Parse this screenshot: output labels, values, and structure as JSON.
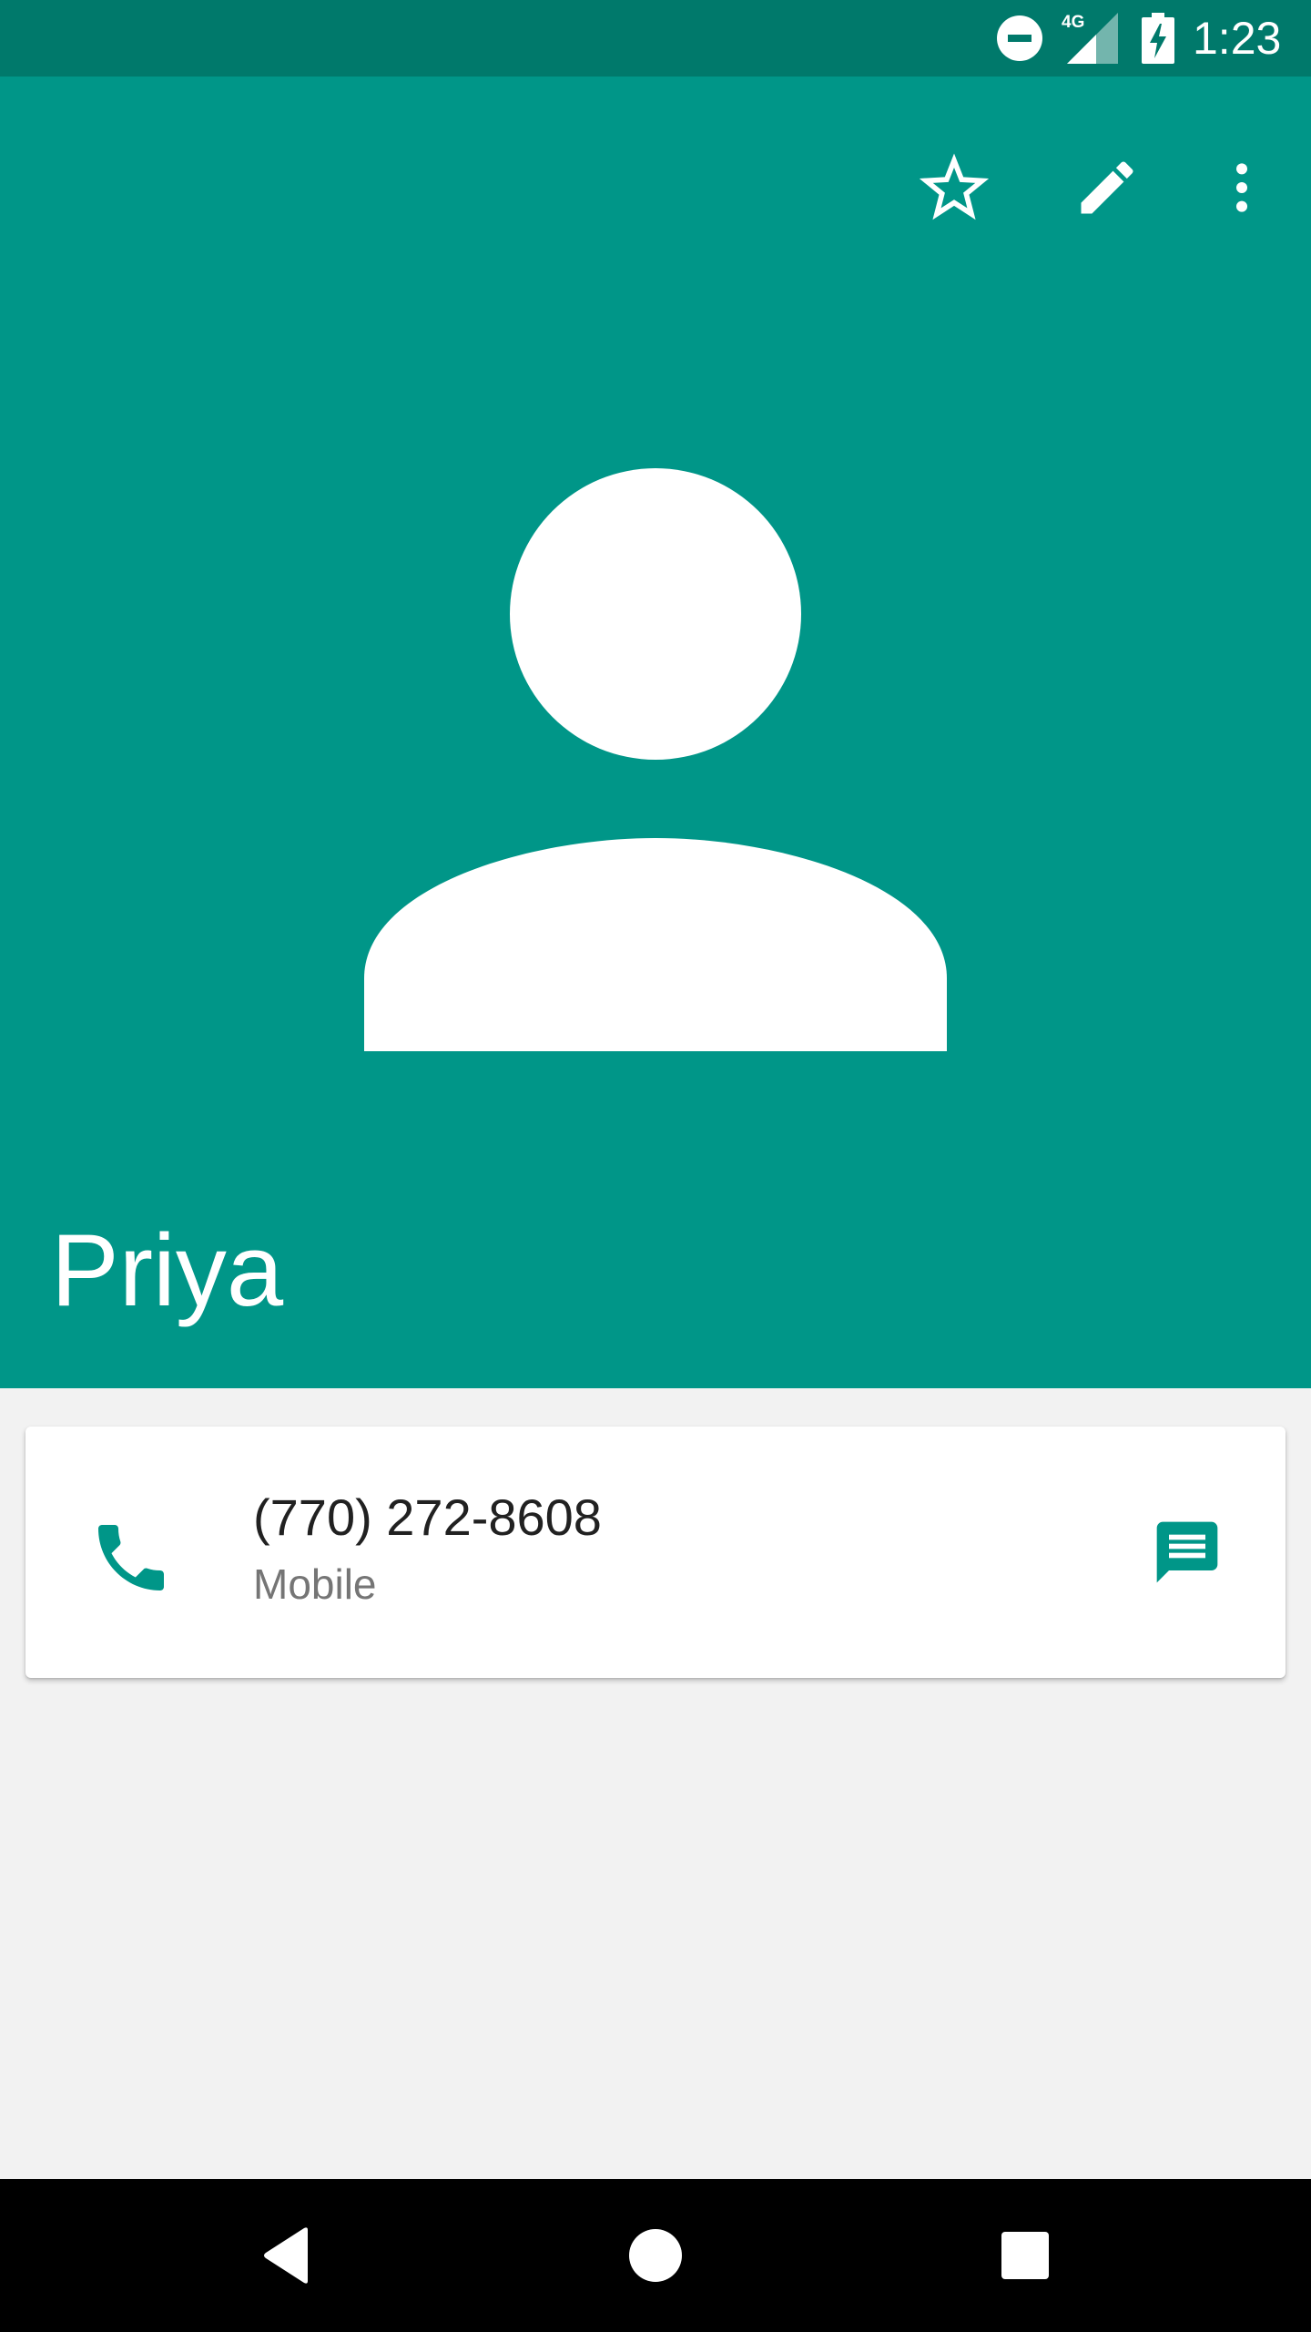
{
  "status_bar": {
    "network_label": "4G",
    "time": "1:23",
    "icons": [
      "do-not-disturb-icon",
      "signal-4g-icon",
      "battery-charging-icon"
    ],
    "background_color": "#00796b"
  },
  "toolbar": {
    "actions": [
      "star-icon",
      "edit-icon",
      "more-vert-icon"
    ]
  },
  "contact": {
    "name": "Priya",
    "avatar_icon": "person-placeholder-icon",
    "header_color": "#009688"
  },
  "phone_entry": {
    "number": "(770) 272-8608",
    "type": "Mobile",
    "call_icon": "phone-icon",
    "message_icon": "message-icon",
    "accent_color": "#009688"
  },
  "navigation_bar": {
    "buttons": [
      "back-icon",
      "home-icon",
      "recents-icon"
    ]
  }
}
